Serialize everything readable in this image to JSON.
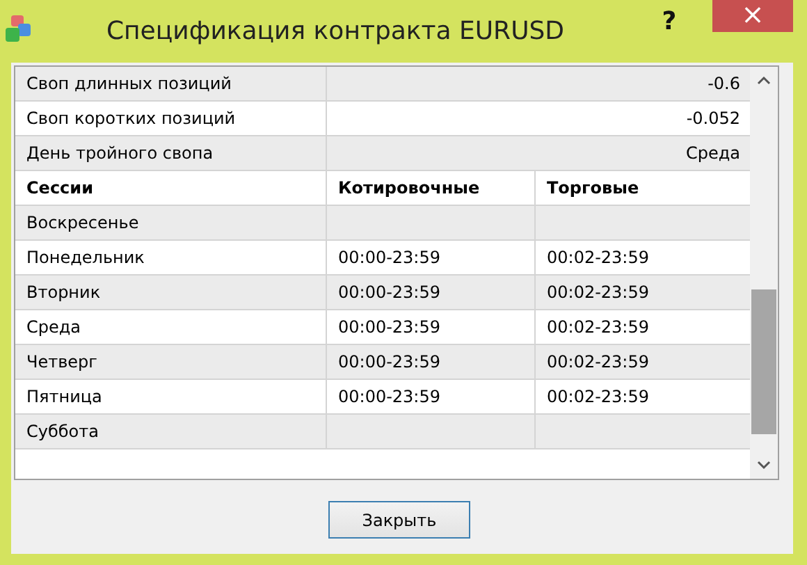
{
  "window": {
    "title": "Спецификация контракта EURUSD",
    "help_button": "?",
    "close_button": "×"
  },
  "specs": [
    {
      "label": "Своп длинных позиций",
      "value": "-0.6"
    },
    {
      "label": "Своп коротких позиций",
      "value": "-0.052"
    },
    {
      "label": "День тройного свопа",
      "value": "Среда"
    }
  ],
  "sessions": {
    "columns": [
      "Сессии",
      "Котировочные",
      "Торговые"
    ],
    "rows": [
      {
        "day": "Воскресенье"
      },
      {
        "day": "Понедельник",
        "quote": "00:00-23:59",
        "trade": "00:02-23:59"
      },
      {
        "day": "Вторник",
        "quote": "00:00-23:59",
        "trade": "00:02-23:59"
      },
      {
        "day": "Среда",
        "quote": "00:00-23:59",
        "trade": "00:02-23:59"
      },
      {
        "day": "Четверг",
        "quote": "00:00-23:59",
        "trade": "00:02-23:59"
      },
      {
        "day": "Пятница",
        "quote": "00:00-23:59",
        "trade": "00:02-23:59"
      },
      {
        "day": "Суббота"
      }
    ]
  },
  "buttons": [
    "Закрыть"
  ]
}
